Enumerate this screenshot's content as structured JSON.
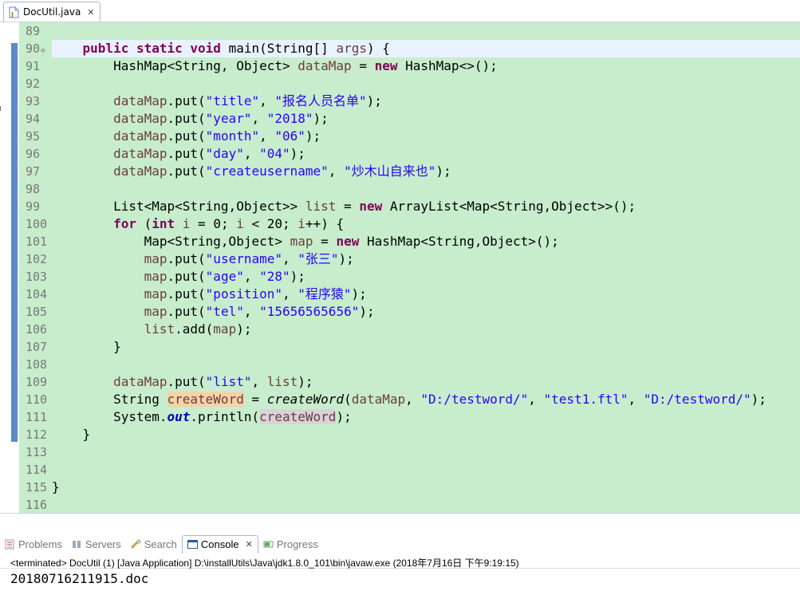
{
  "editor": {
    "tab_label": "DocUtil.java",
    "tab_close": "✕",
    "line_numbers": [
      "89",
      "90",
      "91",
      "92",
      "93",
      "94",
      "95",
      "96",
      "97",
      "98",
      "99",
      "100",
      "101",
      "102",
      "103",
      "104",
      "105",
      "106",
      "107",
      "108",
      "109",
      "110",
      "111",
      "112",
      "113",
      "114",
      "115",
      "116"
    ],
    "current_line": "90",
    "fold_marker": "⊖",
    "code_lines": [
      "",
      "    public static void main(String[] args) {",
      "        HashMap<String, Object> dataMap = new HashMap<>();",
      "",
      "        dataMap.put(\"title\", \"报名人员名单\");",
      "        dataMap.put(\"year\", \"2018\");",
      "        dataMap.put(\"month\", \"06\");",
      "        dataMap.put(\"day\", \"04\");",
      "        dataMap.put(\"createusername\", \"炒木山自来也\");",
      "",
      "        List<Map<String,Object>> list = new ArrayList<Map<String,Object>>();",
      "        for (int i = 0; i < 20; i++) {",
      "            Map<String,Object> map = new HashMap<String,Object>();",
      "            map.put(\"username\", \"张三\");",
      "            map.put(\"age\", \"28\");",
      "            map.put(\"position\", \"程序猿\");",
      "            map.put(\"tel\", \"15656565656\");",
      "            list.add(map);",
      "        }",
      "",
      "        dataMap.put(\"list\", list);",
      "        String createWord = createWord(dataMap, \"D:/testword/\", \"test1.ftl\", \"D:/testword/\");",
      "        System.out.println(createWord);",
      "    }",
      "",
      "",
      "}",
      ""
    ]
  },
  "views": {
    "tabs": [
      {
        "label": "Problems",
        "icon": "problems-icon"
      },
      {
        "label": "Servers",
        "icon": "servers-icon"
      },
      {
        "label": "Search",
        "icon": "search-icon"
      },
      {
        "label": "Console",
        "icon": "console-icon"
      },
      {
        "label": "Progress",
        "icon": "progress-icon"
      }
    ],
    "active_tab": "Console",
    "close_glyph": "✕",
    "console_status": "<terminated> DocUtil (1) [Java Application] D:\\installUtils\\Java\\jdk1.8.0_101\\bin\\javaw.exe (2018年7月16日 下午9:19:15)",
    "console_output": "20180716211915.doc"
  },
  "colors": {
    "editor_background": "#c7edcc",
    "keyword": "#7f0055",
    "string": "#2a00ff",
    "local_variable": "#6a3e3e",
    "static_field": "#0000c0",
    "current_line": "#e8f2fe",
    "change_bar": "#5b89c9"
  }
}
